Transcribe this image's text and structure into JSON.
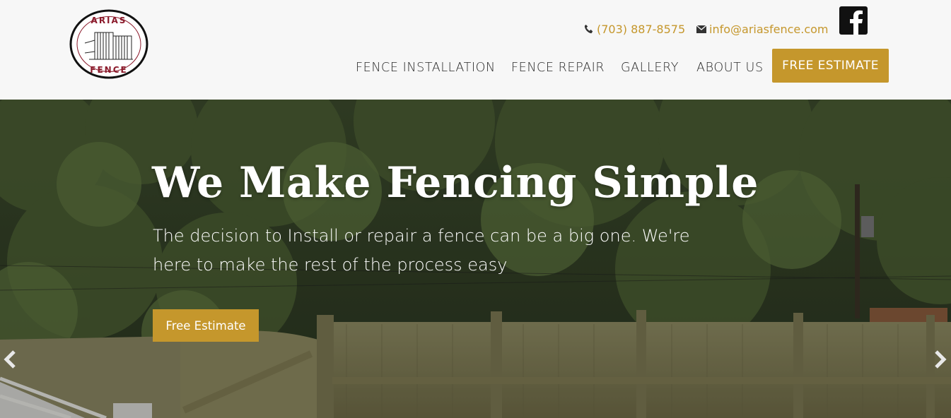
{
  "header": {
    "logo": {
      "top_text": "ARIAS",
      "bottom_text": "FENCE"
    },
    "contact": {
      "phone": "(703) 887-8575",
      "email": "info@ariasfence.com"
    },
    "social": {
      "facebook_icon": "facebook-icon"
    },
    "nav": [
      {
        "label": "FENCE INSTALLATION"
      },
      {
        "label": "FENCE REPAIR"
      },
      {
        "label": "GALLERY"
      },
      {
        "label": "ABOUT US"
      }
    ],
    "cta_label": "FREE ESTIMATE"
  },
  "hero": {
    "title": "We Make Fencing Simple",
    "subtitle": "The decision to Install or repair a fence can be a big one. We're here to make the rest of the process easy",
    "cta_label": "Free Estimate"
  },
  "colors": {
    "accent": "#c5972c",
    "logo_red": "#8b1a2b"
  }
}
